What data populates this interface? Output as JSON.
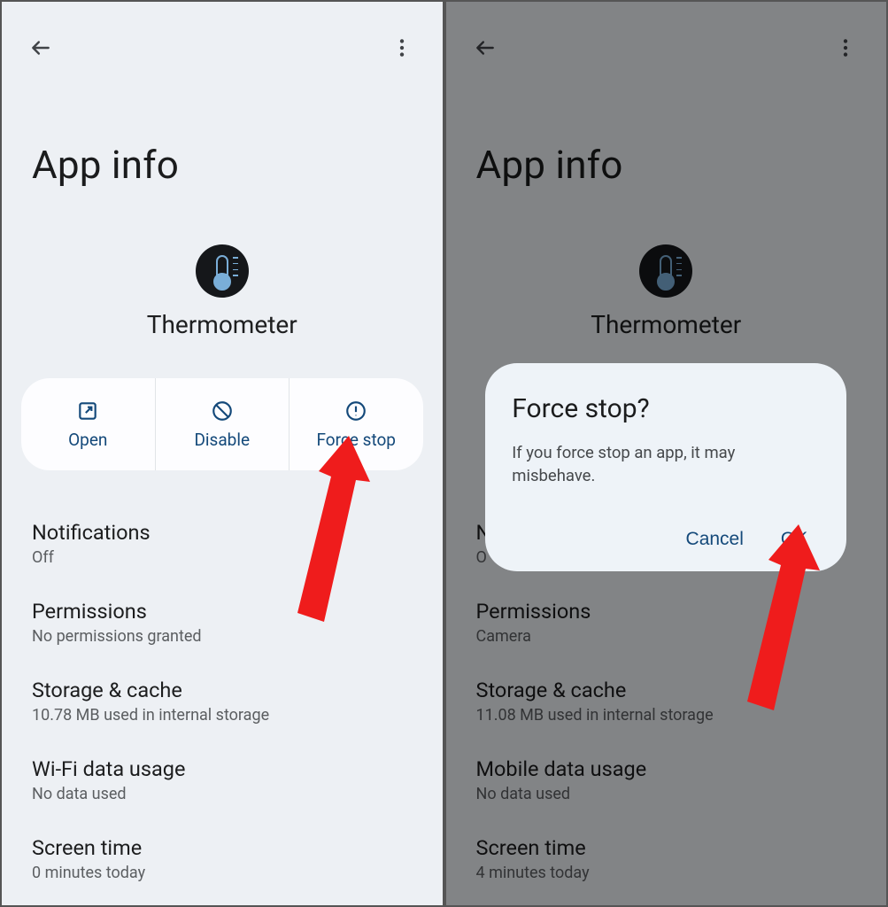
{
  "left": {
    "page_title": "App info",
    "app_name": "Thermometer",
    "actions": {
      "open": "Open",
      "disable": "Disable",
      "force_stop": "Force stop"
    },
    "items": [
      {
        "title": "Notifications",
        "sub": "Off"
      },
      {
        "title": "Permissions",
        "sub": "No permissions granted"
      },
      {
        "title": "Storage & cache",
        "sub": "10.78 MB used in internal storage"
      },
      {
        "title": "Wi-Fi data usage",
        "sub": "No data used"
      },
      {
        "title": "Screen time",
        "sub": "0 minutes today"
      }
    ]
  },
  "right": {
    "page_title": "App info",
    "app_name": "Thermometer",
    "items": [
      {
        "title": "N",
        "sub": "O"
      },
      {
        "title": "Permissions",
        "sub": "Camera"
      },
      {
        "title": "Storage & cache",
        "sub": "11.08 MB used in internal storage"
      },
      {
        "title": "Mobile data usage",
        "sub": "No data used"
      },
      {
        "title": "Screen time",
        "sub": "4 minutes today"
      }
    ],
    "dialog": {
      "title": "Force stop?",
      "message": "If you force stop an app, it may misbehave.",
      "cancel": "Cancel",
      "ok": "OK"
    }
  }
}
